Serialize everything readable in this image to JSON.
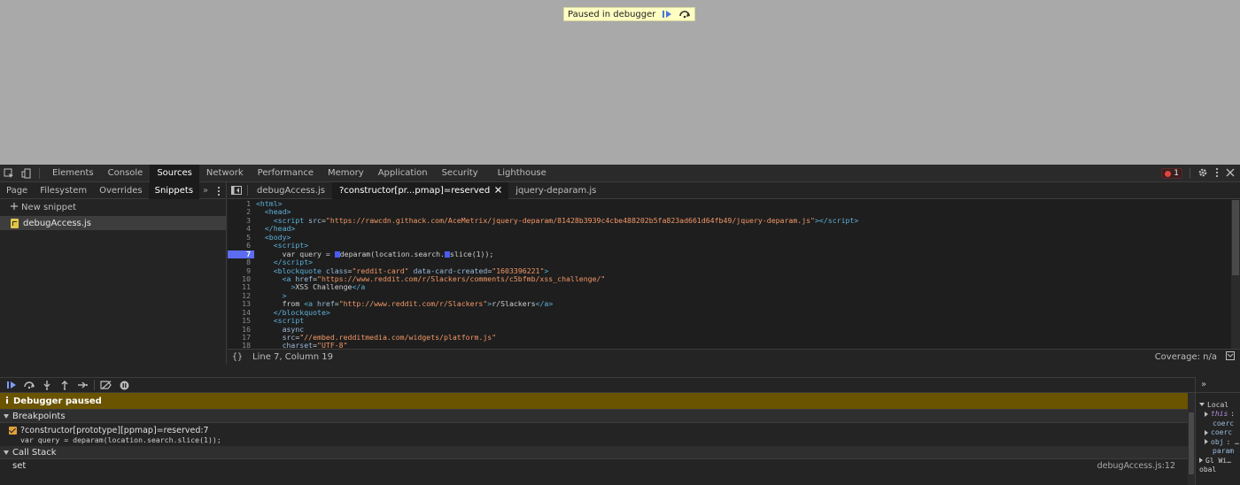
{
  "page": {
    "paused_banner": {
      "text": "Paused in debugger",
      "resume_icon": "resume-icon",
      "step_over_icon": "step-over-icon"
    }
  },
  "devtools": {
    "top_tabs": [
      "Elements",
      "Console",
      "Sources",
      "Network",
      "Performance",
      "Memory",
      "Application",
      "Security",
      "Lighthouse"
    ],
    "active_top_tab": "Sources",
    "error_count": "1",
    "navigator": {
      "tabs": [
        "Page",
        "Filesystem",
        "Overrides",
        "Snippets"
      ],
      "active_tab": "Snippets",
      "more": "»",
      "new_snippet": "New snippet",
      "files": [
        "debugAccess.js"
      ]
    },
    "editor": {
      "tabs": [
        "debugAccess.js",
        "?constructor[pr...pmap]=reserved",
        "jquery-deparam.js"
      ],
      "active_tab_index": 1,
      "breakpoint_line": 7,
      "lines": [
        {
          "n": "1",
          "html": "<span class='tag'>&lt;html&gt;</span>"
        },
        {
          "n": "2",
          "html": "  <span class='tag'>&lt;head&gt;</span>"
        },
        {
          "n": "3",
          "html": "    <span class='tag'>&lt;script</span> <span class='attr'>src</span>=<span class='str'>\"https://rawcdn.githack.com/AceMetrix/jquery-deparam/81428b3939c4cbe488202b5fa823ad661d64fb49/jquery-deparam.js\"</span><span class='tag'>&gt;&lt;/script&gt;</span>"
        },
        {
          "n": "4",
          "html": "  <span class='tag'>&lt;/head&gt;</span>"
        },
        {
          "n": "5",
          "html": "  <span class='tag'>&lt;body&gt;</span>"
        },
        {
          "n": "6",
          "html": "    <span class='tag'>&lt;script&gt;</span>"
        },
        {
          "n": "7",
          "html": "      var query = <span class='mark'></span>deparam(location.search.<span class='mark'></span>slice(1));"
        },
        {
          "n": "8",
          "html": "    <span class='tag'>&lt;/script&gt;</span>"
        },
        {
          "n": "9",
          "html": "    <span class='tag'>&lt;blockquote</span> <span class='attr'>class</span>=<span class='str'>\"reddit-card\"</span> <span class='attr'>data-card-created</span>=<span class='str'>\"1603396221\"</span><span class='tag'>&gt;</span>"
        },
        {
          "n": "10",
          "html": "      <span class='tag'>&lt;a</span> <span class='attr'>href</span>=<span class='str'>\"https://www.reddit.com/r/Slackers/comments/c5bfmb/xss_challenge/\"</span>"
        },
        {
          "n": "11",
          "html": "        <span class='tag'>&gt;</span>XSS Challenge<span class='tag'>&lt;/a</span>"
        },
        {
          "n": "12",
          "html": "      <span class='tag'>&gt;</span>"
        },
        {
          "n": "13",
          "html": "      from <span class='tag'>&lt;a</span> <span class='attr'>href</span>=<span class='str'>\"http://www.reddit.com/r/Slackers\"</span><span class='tag'>&gt;</span>r/Slackers<span class='tag'>&lt;/a&gt;</span>"
        },
        {
          "n": "14",
          "html": "    <span class='tag'>&lt;/blockquote&gt;</span>"
        },
        {
          "n": "15",
          "html": "    <span class='tag'>&lt;script</span>"
        },
        {
          "n": "16",
          "html": "      <span class='attr'>async</span>"
        },
        {
          "n": "17",
          "html": "      <span class='attr'>src</span>=<span class='str'>\"//embed.redditmedia.com/widgets/platform.js\"</span>"
        },
        {
          "n": "18",
          "html": "      <span class='attr'>charset</span>=<span class='str'>\"UTF-8\"</span>"
        },
        {
          "n": "19",
          "html": "    <span class='tag'>&gt;&lt;/script&gt;</span>"
        }
      ],
      "status_braces": "{}",
      "cursor_position": "Line 7, Column 19",
      "coverage": "Coverage: n/a"
    },
    "debugger": {
      "paused_label": "Debugger paused",
      "breakpoints_header": "Breakpoints",
      "breakpoint_location": "?constructor[prototype][ppmap]=reserved:7",
      "breakpoint_code": "var query = deparam(location.search.slice(1));",
      "call_stack_header": "Call Stack",
      "call_stack": [
        {
          "fn": "set",
          "loc": "debugAccess.js:12"
        }
      ]
    },
    "scope": {
      "more": "»",
      "local_label": "Local",
      "entries": [
        {
          "arrow": true,
          "key": "this",
          "val": ":"
        },
        {
          "arrow": false,
          "key": "coerc",
          "val": ""
        },
        {
          "arrow": true,
          "key": "coerc",
          "val": ""
        },
        {
          "arrow": true,
          "key": "obj",
          "val": ": …"
        },
        {
          "arrow": false,
          "key": "param",
          "val": ""
        }
      ],
      "global_label": "Gl Wi…",
      "global_label2": "obal"
    }
  }
}
